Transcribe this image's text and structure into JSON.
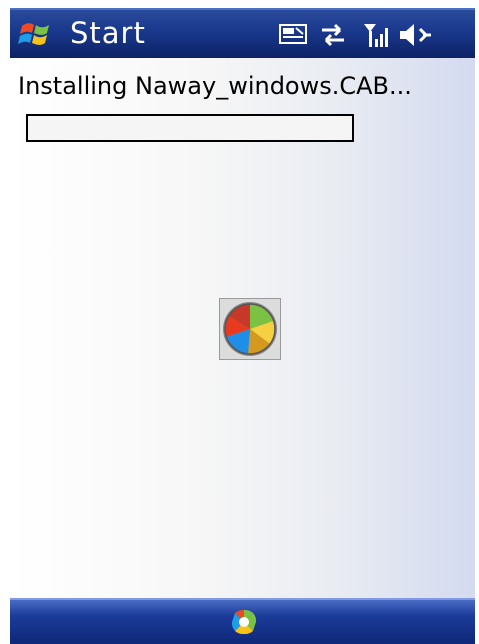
{
  "titlebar": {
    "start_label": "Start",
    "icons": [
      "windows-flag-icon",
      "phone-status-icon",
      "connectivity-icon",
      "signal-strength-icon",
      "volume-icon"
    ]
  },
  "content": {
    "installing_text": "Installing Naway_windows.CAB...",
    "progress_fraction": 0
  },
  "busy_indicator": {
    "icon": "windows-busy-icon"
  },
  "bottombar": {
    "icon": "windows-logo-icon"
  }
}
